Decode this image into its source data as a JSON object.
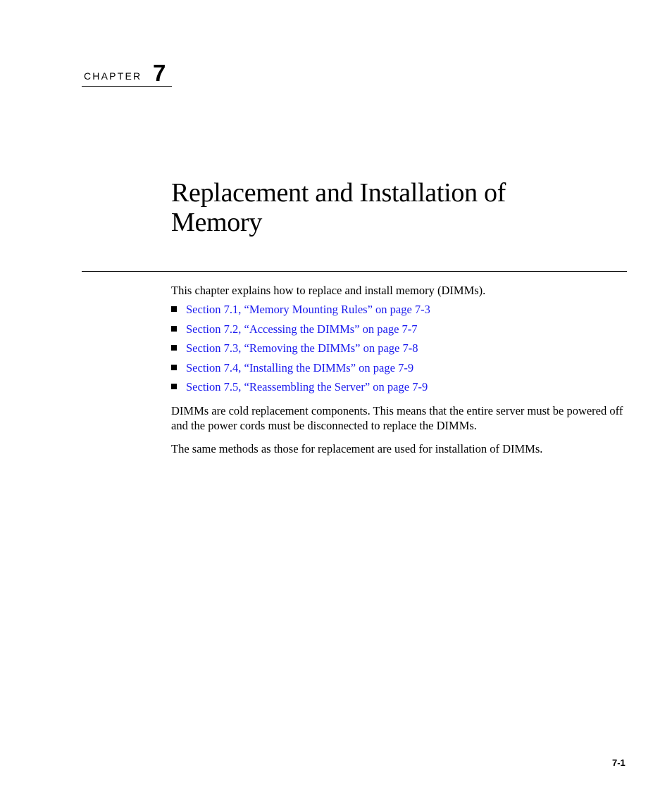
{
  "chapter": {
    "label": "CHAPTER",
    "number": "7"
  },
  "title": "Replacement and Installation of Memory",
  "intro": "This chapter explains how to replace and install memory (DIMMs).",
  "links": [
    {
      "text": "Section 7.1, “Memory Mounting Rules” on page 7-3"
    },
    {
      "text": "Section 7.2, “Accessing the DIMMs” on page 7-7"
    },
    {
      "text": "Section 7.3, “Removing the DIMMs” on page 7-8"
    },
    {
      "text": "Section 7.4, “Installing the DIMMs” on page 7-9"
    },
    {
      "text": "Section 7.5, “Reassembling the Server” on page 7-9"
    }
  ],
  "paragraphs": [
    "DIMMs are cold replacement components. This means that the entire server must be powered off and the power cords must be disconnected to replace the DIMMs.",
    "The same methods as those for replacement are used for installation of DIMMs."
  ],
  "page_number": "7-1",
  "colors": {
    "link": "#1a1aee",
    "text": "#000000"
  }
}
